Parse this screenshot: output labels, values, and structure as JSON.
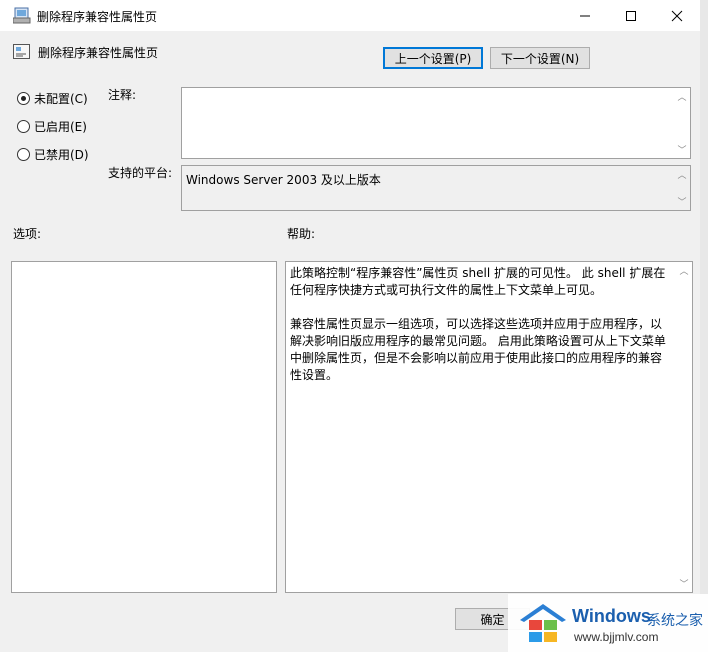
{
  "window": {
    "title": "删除程序兼容性属性页"
  },
  "header": {
    "policy_title": "删除程序兼容性属性页"
  },
  "nav": {
    "prev_label": "上一个设置(P)",
    "next_label": "下一个设置(N)"
  },
  "options": {
    "not_configured": "未配置(C)",
    "enabled": "已启用(E)",
    "disabled": "已禁用(D)"
  },
  "comment": {
    "label": "注释:",
    "value": ""
  },
  "platform": {
    "label": "支持的平台:",
    "value": "Windows Server 2003 及以上版本"
  },
  "sections": {
    "options_label": "选项:",
    "help_label": "帮助:"
  },
  "help": {
    "p1": "此策略控制“程序兼容性”属性页 shell 扩展的可见性。 此 shell 扩展在任何程序快捷方式或可执行文件的属性上下文菜单上可见。",
    "p2": "兼容性属性页显示一组选项，可以选择这些选项并应用于应用程序，以解决影响旧版应用程序的最常见问题。 启用此策略设置可从上下文菜单中删除属性页，但是不会影响以前应用于使用此接口的应用程序的兼容性设置。"
  },
  "footer": {
    "ok_label": "确定"
  },
  "watermark": {
    "brand": "Windows",
    "suffix": "系统之家",
    "url": "www.bjjmlv.com"
  },
  "colors": {
    "accent": "#0078d7",
    "window_bg": "#f0f0f0"
  }
}
